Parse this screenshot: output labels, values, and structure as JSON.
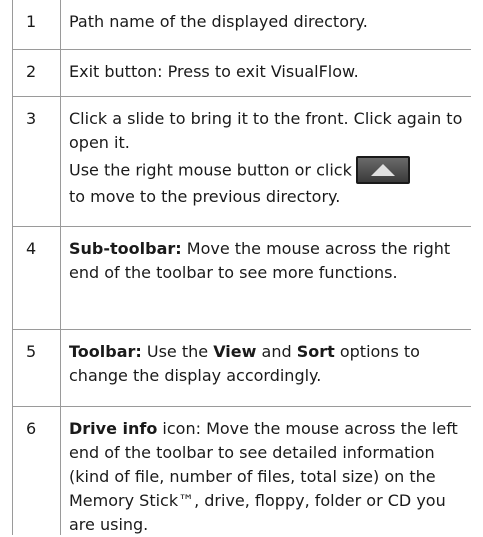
{
  "rows": [
    {
      "num": "1",
      "text": "Path name of the displayed directory."
    },
    {
      "num": "2",
      "text": "Exit button: Press to exit VisualFlow."
    },
    {
      "num": "3",
      "line1": "Click a slide to bring it to the front. Click again to open it.",
      "line2a": "Use the right mouse button or click",
      "line2b": "to move to the previous directory.",
      "button_icon": "up-arrow-icon"
    },
    {
      "num": "4",
      "bold": "Sub-toolbar:",
      "text": " Move the mouse across the right end of the toolbar to see more functions."
    },
    {
      "num": "5",
      "bold": "Toolbar:",
      "t1": " Use the ",
      "b2": "View",
      "t2": " and ",
      "b3": "Sort",
      "t3": " options to change the display accordingly."
    },
    {
      "num": "6",
      "bold": "Drive info",
      "text": " icon: Move the mouse across the left end of the toolbar to see detailed information (kind of file, number of files, total size) on the Memory Stick™, drive, floppy, folder or CD you are using."
    }
  ],
  "colors": {
    "border": "#9a9a9a",
    "button_bg": "#4a4a4a",
    "button_arrow": "#e0e0e0"
  }
}
